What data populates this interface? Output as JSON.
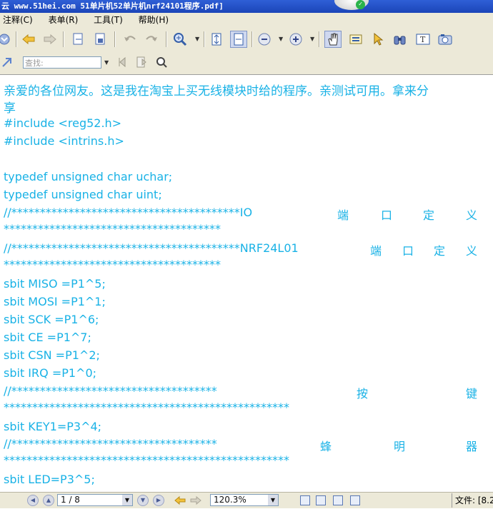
{
  "window": {
    "title": "云 www.51hei.com 51单片机52单片机nrf24101程序.pdf]"
  },
  "menu": {
    "items": [
      "注释(C)",
      "表单(R)",
      "工具(T)",
      "帮助(H)"
    ]
  },
  "toolbar2": {
    "find_placeholder": "查找:"
  },
  "document": {
    "intro_line1": "亲爱的各位网友。这是我在淘宝上买无线模块时给的程序。亲测试可用。拿来分",
    "intro_line2": "享",
    "include1": "#include <reg52.h>",
    "include2": "#include <intrins.h>",
    "typedef1": "typedef unsigned char uchar;",
    "typedef2": "typedef unsigned char uint;",
    "io_comment_prefix": "//****************************************IO",
    "io_comment_words": [
      "端",
      "口",
      "定",
      "义"
    ],
    "stars_38": "**************************************",
    "nrf_comment_prefix": "//****************************************NRF24L01",
    "nrf_comment_words": [
      "端",
      "口",
      "定",
      "义"
    ],
    "sbit_lines": [
      "sbit MISO     =P1^5;",
      "sbit MOSI     =P1^1;",
      "sbit SCK        =P1^6;",
      "sbit CE          =P1^7;",
      "sbit CSN       =P1^2;",
      "sbit IRQ        =P1^0;"
    ],
    "key_comment_prefix": "//************************************",
    "key_comment_words": [
      "按",
      "键"
    ],
    "stars_50": "**************************************************",
    "key_line": "sbit KEY1=P3^4;",
    "buzzer_comment_prefix": "//************************************",
    "buzzer_comment_words": [
      "蜂",
      "明",
      "器"
    ],
    "led_line": "sbit LED=P3^5;"
  },
  "status": {
    "page": "1 / 8",
    "zoom": "120.3%",
    "file_label": "文件: [8.2"
  },
  "colors": {
    "text": "#19b2e6",
    "titlebar": "#1b45b8",
    "chrome": "#ece9d8"
  }
}
